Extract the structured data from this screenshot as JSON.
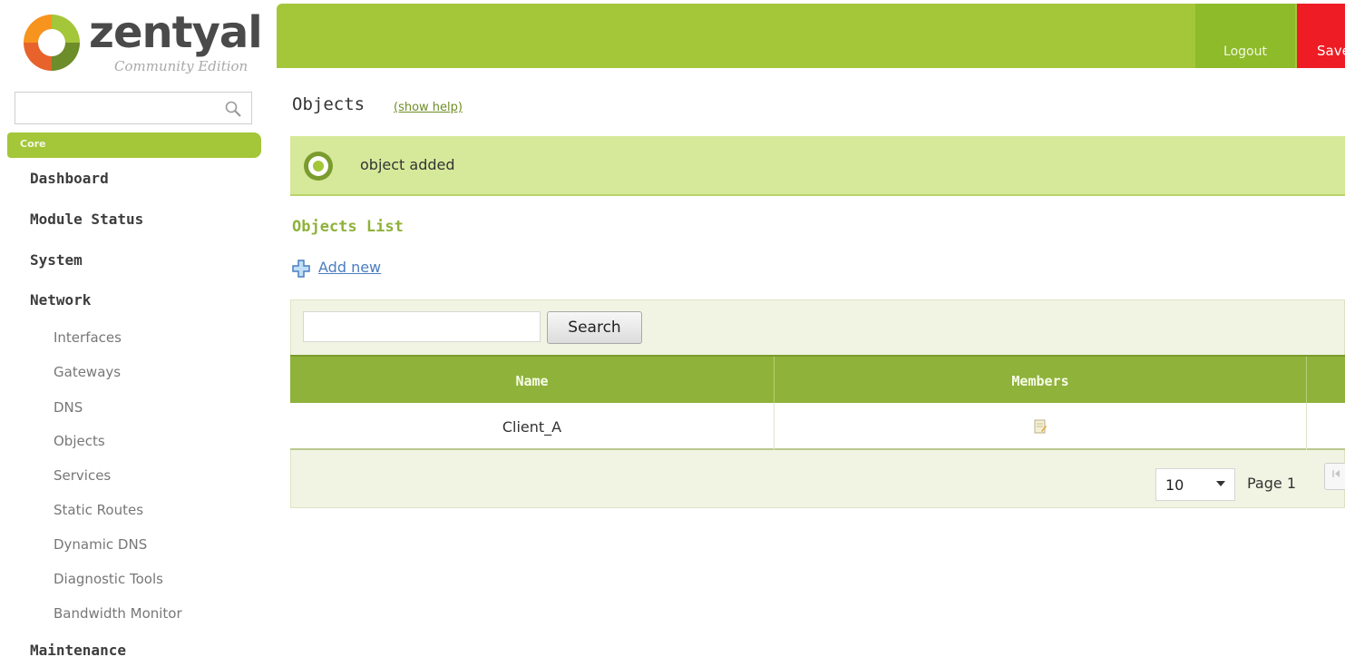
{
  "brand": {
    "name": "zentyal",
    "edition": "Community Edition",
    "accent_color": "#a4c639",
    "logo_colors": [
      "#f7941e",
      "#e8632b",
      "#a4c639",
      "#6d8c2a"
    ]
  },
  "header": {
    "logout_label": "Logout",
    "save_label": "Save"
  },
  "sidebar": {
    "search_placeholder": "",
    "section_label": "Core",
    "items": [
      {
        "label": "Dashboard"
      },
      {
        "label": "Module Status"
      },
      {
        "label": "System"
      },
      {
        "label": "Network"
      }
    ],
    "network_subitems": [
      {
        "label": "Interfaces"
      },
      {
        "label": "Gateways"
      },
      {
        "label": "DNS"
      },
      {
        "label": "Objects"
      },
      {
        "label": "Services"
      },
      {
        "label": "Static Routes"
      },
      {
        "label": "Dynamic DNS"
      },
      {
        "label": "Diagnostic Tools"
      },
      {
        "label": "Bandwidth Monitor"
      }
    ],
    "maintenance_label": "Maintenance"
  },
  "main": {
    "title": "Objects",
    "help_link": "(show help)",
    "notice": "object added",
    "list_title": "Objects List",
    "add_new_label": "Add new",
    "search_button": "Search",
    "search_value": "",
    "columns": [
      "Name",
      "Members"
    ],
    "rows": [
      {
        "name": "Client_A",
        "members_icon": "edit-members-icon"
      }
    ],
    "page_size": "10",
    "page_label": "Page 1"
  }
}
